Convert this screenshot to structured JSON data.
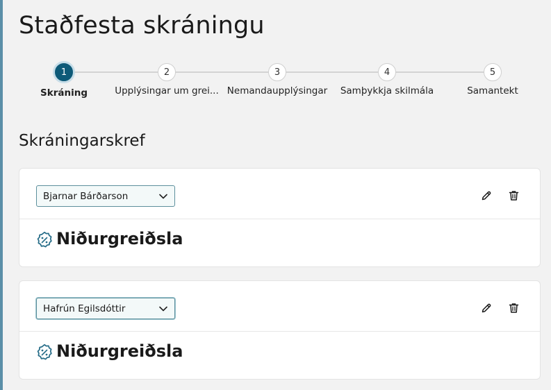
{
  "page": {
    "title": "Staðfesta skráningu"
  },
  "stepper": {
    "steps": [
      {
        "number": "1",
        "label": "Skráning",
        "active": true
      },
      {
        "number": "2",
        "label": "Upplýsingar um grei...",
        "active": false
      },
      {
        "number": "3",
        "label": "Nemandaupplýsingar",
        "active": false
      },
      {
        "number": "4",
        "label": "Samþykkja skilmála",
        "active": false
      },
      {
        "number": "5",
        "label": "Samantekt",
        "active": false
      }
    ]
  },
  "section": {
    "title": "Skráningarskref"
  },
  "cards": [
    {
      "student": "Bjarnar Bárðarson",
      "heading": "Niðurgreiðsla"
    },
    {
      "student": "Hafrún Egilsdóttir",
      "heading": "Niðurgreiðsla"
    }
  ],
  "icons": {
    "edit": "pencil-icon",
    "delete": "trash-icon",
    "badge": "discount-badge-icon",
    "select": "chevron-down-icon"
  },
  "colors": {
    "active_step": "#0e5a78",
    "accent": "#0e5a78",
    "select_border": "#5c8f9c",
    "select_bg": "#f3f9f9"
  }
}
